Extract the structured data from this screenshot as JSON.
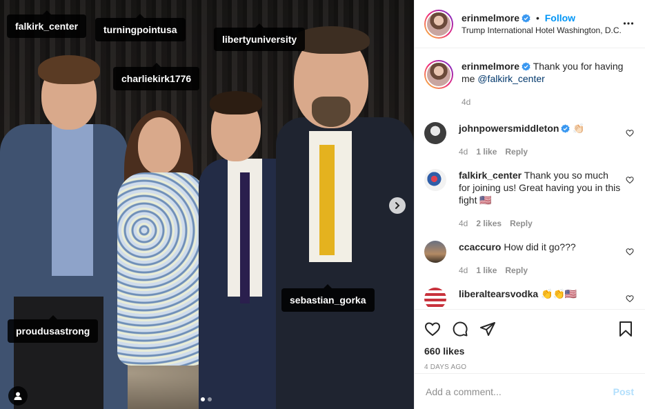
{
  "photo": {
    "tags": [
      {
        "username": "falkirk_center"
      },
      {
        "username": "turningpointusa"
      },
      {
        "username": "libertyuniversity"
      },
      {
        "username": "charliekirk1776"
      },
      {
        "username": "sebastian_gorka"
      },
      {
        "username": "proudusastrong"
      }
    ],
    "carousel_count": 2,
    "carousel_active": 1
  },
  "header": {
    "username": "erinmelmore",
    "follow_label": "Follow",
    "separator": "•",
    "location": "Trump International Hotel Washington, D.C."
  },
  "caption": {
    "username": "erinmelmore",
    "text": "Thank you for having me ",
    "mention": "@falkirk_center",
    "age": "4d"
  },
  "comments": [
    {
      "username": "johnpowersmiddleton",
      "verified": true,
      "text": "👏🏻",
      "age": "4d",
      "likes": "1 like",
      "reply": "Reply"
    },
    {
      "username": "falkirk_center",
      "verified": false,
      "text": "Thank you so much for joining us! Great having you in this fight 🇺🇸",
      "age": "4d",
      "likes": "2 likes",
      "reply": "Reply"
    },
    {
      "username": "ccaccuro",
      "verified": false,
      "text": "How did it go???",
      "age": "4d",
      "likes": "1 like",
      "reply": "Reply"
    },
    {
      "username": "liberaltearsvodka",
      "verified": false,
      "text": "👏👏🇺🇸",
      "age": "",
      "likes": "",
      "reply": ""
    }
  ],
  "actions": {
    "likes": "660 likes",
    "timestamp": "4 DAYS AGO"
  },
  "add_comment": {
    "placeholder": "Add a comment...",
    "post_label": "Post"
  },
  "colors": {
    "link_blue": "#0095f6",
    "mention": "#00376b",
    "muted": "#8e8e8e",
    "post_disabled": "#b2dffc"
  }
}
